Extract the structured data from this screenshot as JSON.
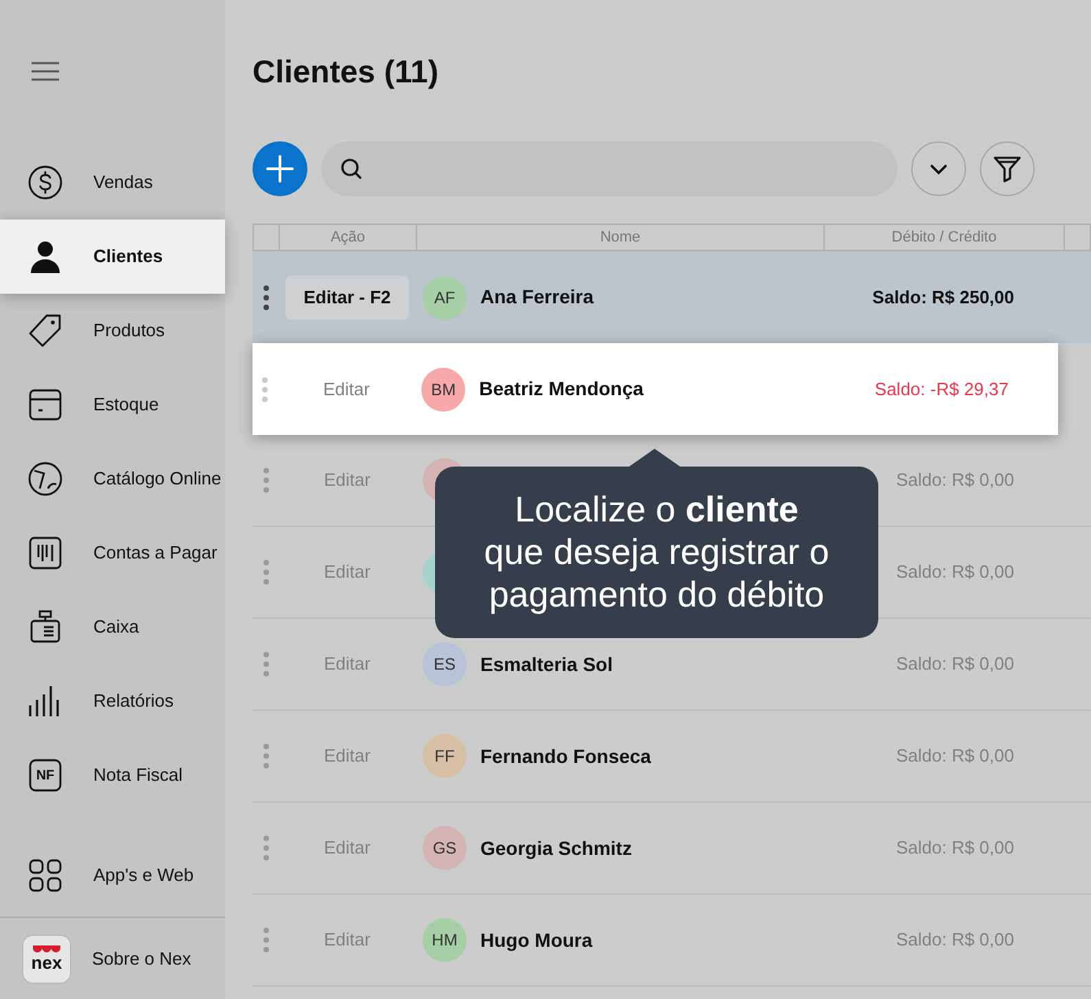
{
  "sidebar": {
    "items": [
      {
        "label": "Vendas",
        "selected": false
      },
      {
        "label": "Clientes",
        "selected": true
      },
      {
        "label": "Produtos",
        "selected": false
      },
      {
        "label": "Estoque",
        "selected": false
      },
      {
        "label": "Catálogo Online",
        "selected": false
      },
      {
        "label": "Contas a Pagar",
        "selected": false
      },
      {
        "label": "Caixa",
        "selected": false
      },
      {
        "label": "Relatórios",
        "selected": false
      },
      {
        "label": "Nota Fiscal",
        "selected": false,
        "icon_text": "NF"
      }
    ],
    "bottom_items": [
      {
        "label": "App's e Web"
      }
    ],
    "about": {
      "label": "Sobre o Nex",
      "logo_text": "nex"
    }
  },
  "page": {
    "title": "Clientes (11)"
  },
  "table": {
    "columns": [
      "Ação",
      "Nome",
      "Débito / Crédito"
    ],
    "rows": [
      {
        "action": "Editar - F2",
        "initials": "AF",
        "color": "#a6cfa6",
        "name": "Ana Ferreira",
        "balance": "Saldo: R$ 250,00",
        "kind": "credit",
        "selected": true,
        "spotlit": false
      },
      {
        "action": "Editar",
        "initials": "BM",
        "color": "#f7a9a9",
        "name": "Beatriz Mendonça",
        "balance": "Saldo: -R$ 29,37",
        "kind": "debit",
        "selected": false,
        "spotlit": true
      },
      {
        "action": "Editar",
        "color": "#d6b3b3",
        "balance": "Saldo: R$ 0,00",
        "kind": "zero",
        "selected": false,
        "spotlit": false
      },
      {
        "action": "Editar",
        "color": "#a7d3cc",
        "balance": "Saldo: R$ 0,00",
        "kind": "zero",
        "selected": false,
        "spotlit": false
      },
      {
        "action": "Editar",
        "initials": "ES",
        "color": "#b8c3d8",
        "name": "Esmalteria Sol",
        "balance": "Saldo: R$ 0,00",
        "kind": "zero",
        "selected": false,
        "spotlit": false
      },
      {
        "action": "Editar",
        "initials": "FF",
        "color": "#d8c0a6",
        "name": "Fernando Fonseca",
        "balance": "Saldo: R$ 0,00",
        "kind": "zero",
        "selected": false,
        "spotlit": false
      },
      {
        "action": "Editar",
        "initials": "GS",
        "color": "#d4b4b4",
        "name": "Georgia Schmitz",
        "balance": "Saldo: R$ 0,00",
        "kind": "zero",
        "selected": false,
        "spotlit": false
      },
      {
        "action": "Editar",
        "initials": "HM",
        "color": "#a6cfa6",
        "name": "Hugo Moura",
        "balance": "Saldo: R$ 0,00",
        "kind": "zero",
        "selected": false,
        "spotlit": false
      }
    ]
  },
  "tooltip": {
    "text": "Localize o **cliente**\nque deseja registrar o\npagamento do débito"
  }
}
